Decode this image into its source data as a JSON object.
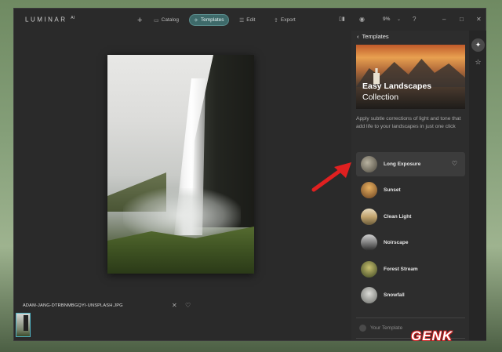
{
  "app": {
    "logo": "LUMINAR",
    "logo_sup": "AI"
  },
  "toolbar": {
    "add_label": "+",
    "catalog_label": "Catalog",
    "templates_label": "Templates",
    "edit_label": "Edit",
    "export_label": "Export",
    "zoom": "9%"
  },
  "canvas": {
    "filename": "ADAM-JANG-DTRBNMBGQYI-UNSPLASH.JPG"
  },
  "panel": {
    "back_label": "Templates",
    "collection_title": "Easy Landscapes",
    "collection_subtitle": "Collection",
    "description": "Apply subtle corrections of light and tone that add life to your landscapes in just one click",
    "templates": [
      {
        "label": "Long Exposure",
        "thumb_color": "#6e6a5e",
        "active": true
      },
      {
        "label": "Sunset",
        "thumb_color": "#a36a34"
      },
      {
        "label": "Clean Light",
        "thumb_color": "#b9a37a"
      },
      {
        "label": "Noirscape",
        "thumb_color": "#8a8a8a"
      },
      {
        "label": "Forest Stream",
        "thumb_color": "#4f5a2e"
      },
      {
        "label": "Snowfall",
        "thumb_color": "#9a9c98"
      }
    ],
    "your_template": "Your Template"
  },
  "watermark": "GENK",
  "colors": {
    "accent": "#3e6a6a",
    "arrow": "#e02020"
  }
}
